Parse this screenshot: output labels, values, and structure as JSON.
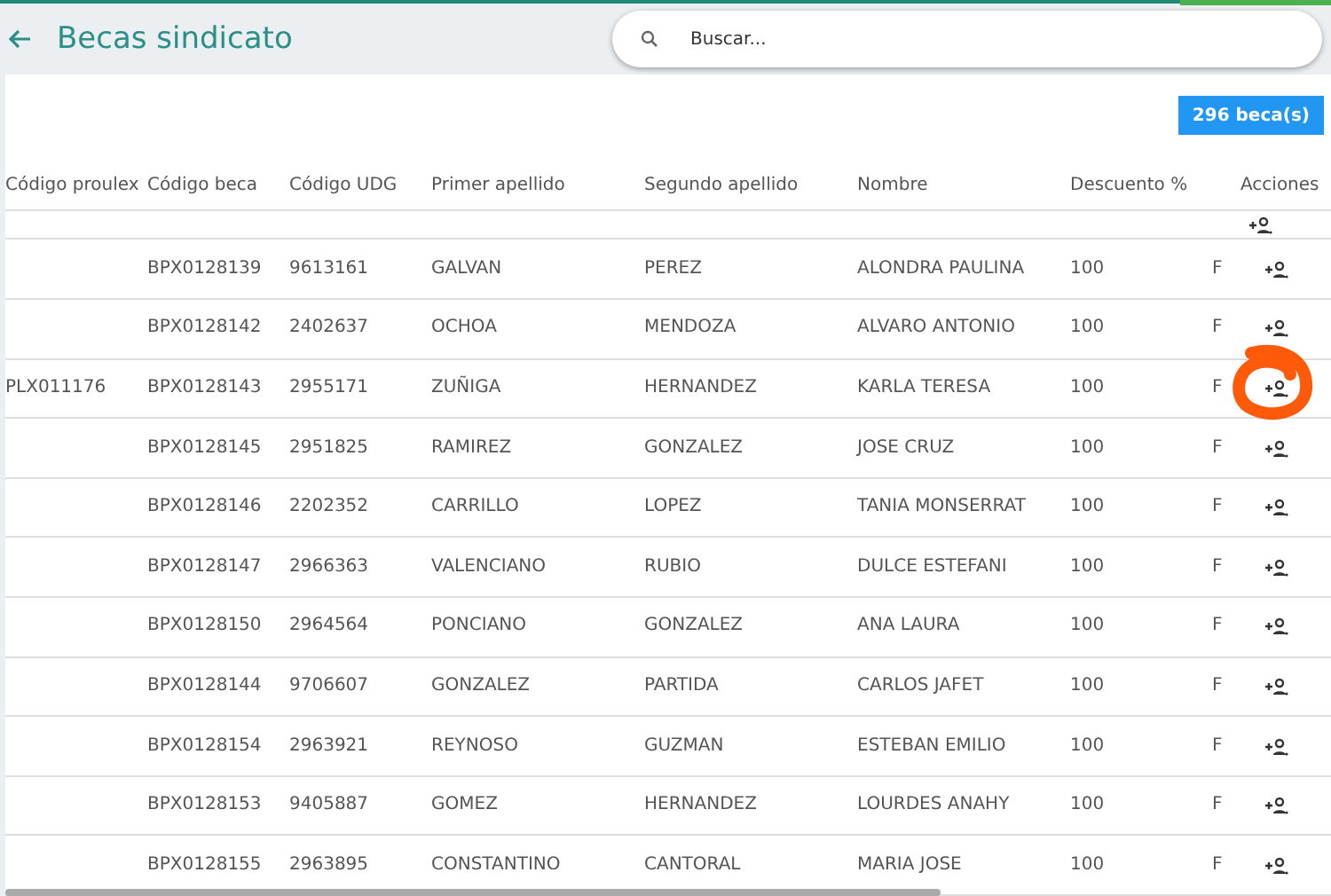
{
  "header": {
    "title": "Becas sindicato",
    "search": {
      "placeholder": "Buscar..."
    }
  },
  "count_badge": "296 beca(s)",
  "table": {
    "columns": [
      "Código proulex",
      "Código beca",
      "Código UDG",
      "Primer apellido",
      "Segundo apellido",
      "Nombre",
      "Descuento %",
      "",
      "Acciones"
    ],
    "rows": [
      {
        "cells": [
          "",
          "BPX0128139",
          "9613161",
          "GALVAN",
          "PEREZ",
          "ALONDRA PAULINA",
          "100",
          "F"
        ],
        "circled": false
      },
      {
        "cells": [
          "",
          "BPX0128142",
          "2402637",
          "OCHOA",
          "MENDOZA",
          "ALVARO ANTONIO",
          "100",
          "F"
        ],
        "circled": false
      },
      {
        "cells": [
          "PLX011176",
          "BPX0128143",
          "2955171",
          "ZUÑIGA",
          "HERNANDEZ",
          "KARLA TERESA",
          "100",
          "F"
        ],
        "circled": true
      },
      {
        "cells": [
          "",
          "BPX0128145",
          "2951825",
          "RAMIREZ",
          "GONZALEZ",
          "JOSE CRUZ",
          "100",
          "F"
        ],
        "circled": false
      },
      {
        "cells": [
          "",
          "BPX0128146",
          "2202352",
          "CARRILLO",
          "LOPEZ",
          "TANIA MONSERRAT",
          "100",
          "F"
        ],
        "circled": false
      },
      {
        "cells": [
          "",
          "BPX0128147",
          "2966363",
          "VALENCIANO",
          "RUBIO",
          "DULCE ESTEFANI",
          "100",
          "F"
        ],
        "circled": false
      },
      {
        "cells": [
          "",
          "BPX0128150",
          "2964564",
          "PONCIANO",
          "GONZALEZ",
          "ANA LAURA",
          "100",
          "F"
        ],
        "circled": false
      },
      {
        "cells": [
          "",
          "BPX0128144",
          "9706607",
          "GONZALEZ",
          "PARTIDA",
          "CARLOS JAFET",
          "100",
          "F"
        ],
        "circled": false
      },
      {
        "cells": [
          "",
          "BPX0128154",
          "2963921",
          "REYNOSO",
          "GUZMAN",
          "ESTEBAN EMILIO",
          "100",
          "F"
        ],
        "circled": false
      },
      {
        "cells": [
          "",
          "BPX0128153",
          "9405887",
          "GOMEZ",
          "HERNANDEZ",
          "LOURDES ANAHY",
          "100",
          "F"
        ],
        "circled": false
      },
      {
        "cells": [
          "",
          "BPX0128155",
          "2963895",
          "CONSTANTINO",
          "CANTORAL",
          "MARIA JOSE",
          "100",
          "F"
        ],
        "circled": false
      }
    ]
  }
}
